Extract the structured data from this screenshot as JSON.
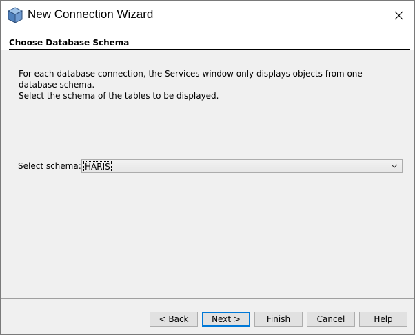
{
  "window": {
    "title": "New Connection Wizard",
    "icon": "netbeans-cube-icon"
  },
  "step": {
    "title": "Choose Database Schema"
  },
  "instructions": {
    "line1": "For each database connection, the Services window only displays objects from one database schema.",
    "line2": "Select the schema of the tables to be displayed."
  },
  "schema": {
    "label": "Select schema:",
    "selected": "HARIS"
  },
  "buttons": {
    "back": "< Back",
    "next": "Next >",
    "finish": "Finish",
    "cancel": "Cancel",
    "help": "Help"
  },
  "colors": {
    "accent": "#0078d7",
    "panel": "#f0f0f0",
    "header": "#ffffff"
  }
}
